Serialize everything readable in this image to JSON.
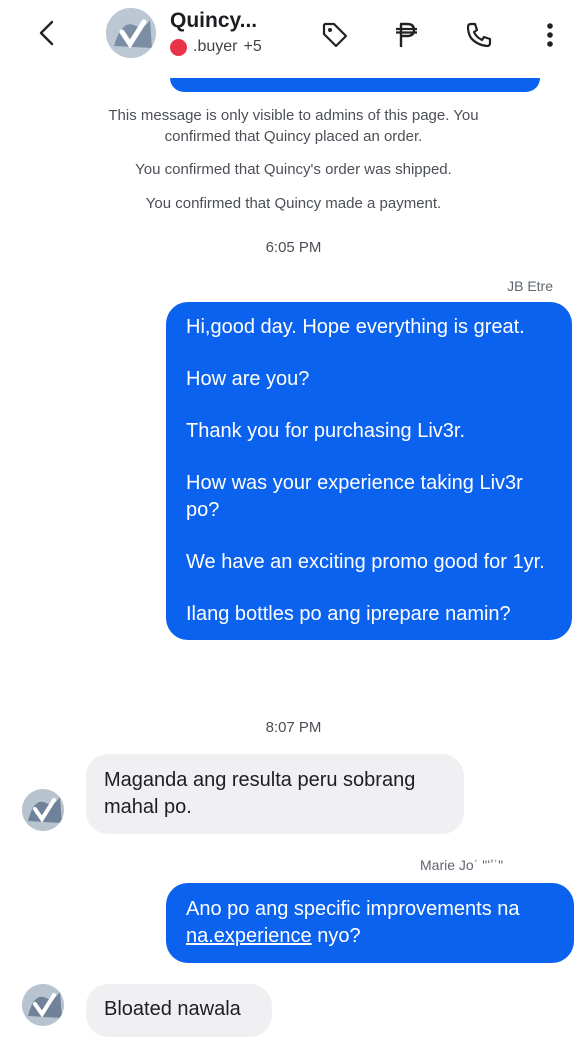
{
  "header": {
    "title": "Quincy...",
    "label": ".buyer",
    "extra": "+5",
    "label_color": "#e8334a",
    "icons": [
      "back-icon",
      "tag-icon",
      "peso-icon",
      "phone-icon",
      "more-icon"
    ]
  },
  "system_messages": {
    "admin_notice": "This message is only visible to admins of this page. You confirmed that Quincy placed an order.",
    "shipped": "You confirmed that Quincy's order was shipped.",
    "payment": "You confirmed that Quincy made a payment."
  },
  "thread": {
    "time1": "6:05 PM",
    "sender1": "JB Etre",
    "outgoing1": [
      "Hi,good day. Hope everything is great.",
      "How are you?",
      "Thank you for purchasing Liv3r.",
      "How was your experience taking Liv3r po?",
      "We have an exciting promo good for 1yr.",
      "Ilang bottles po ang iprepare namin?"
    ],
    "time2": "8:07 PM",
    "incoming1": "Maganda ang resulta peru sobrang mahal po.",
    "sender2": "Marie Joʿ ʺʻʽʾʺ",
    "outgoing2_prefix": "Ano po ang specific improvements na ",
    "outgoing2_link": "na.experience",
    "outgoing2_suffix": " nyo?",
    "incoming2": "Bloated nawala"
  },
  "colors": {
    "accent": "#0b62ef",
    "incoming_bg": "#f0f0f2"
  }
}
